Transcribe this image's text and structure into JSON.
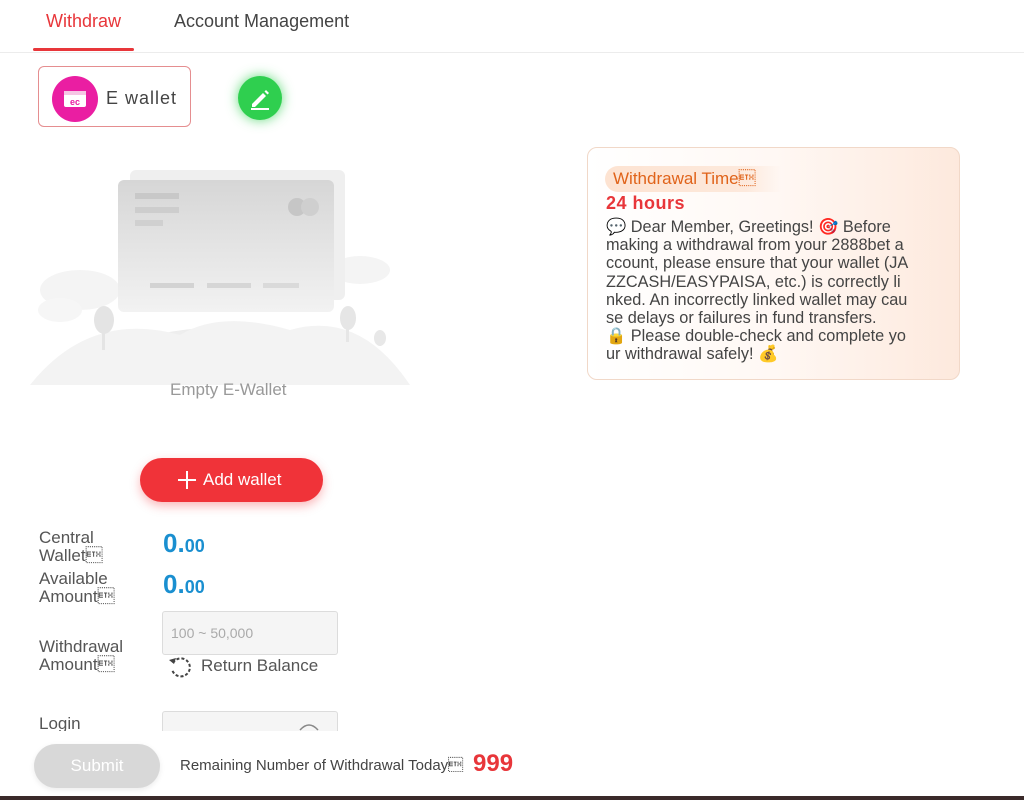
{
  "tabs": [
    {
      "label": "Withdraw",
      "active": true
    },
    {
      "label": "Account Management",
      "active": false
    }
  ],
  "wallet_type": {
    "label": "E wallet",
    "icon": "ewallet-icon",
    "color": "#ea1ea2"
  },
  "edit_icon": "pencil-icon",
  "empty_state": {
    "label": "Empty E-Wallet"
  },
  "add_wallet": {
    "label": "Add wallet",
    "icon": "plus-icon"
  },
  "form": {
    "central_wallet": {
      "label": "Central\nWallet\u0003",
      "value_int": "0.",
      "value_dec": "00"
    },
    "available_amount": {
      "label": "Available\nAmount\u0003",
      "value_int": "0.",
      "value_dec": "00"
    },
    "withdrawal_amount": {
      "label": "Withdrawal\nAmount\u0003",
      "placeholder": "100 ~ 50,000"
    },
    "return_balance": "Return Balance",
    "login_label": "Login"
  },
  "submit_label": "Submit",
  "remaining": {
    "label": "Remaining Number of Withdrawal Today\u0003",
    "count": "999"
  },
  "notice": {
    "time_title": "Withdrawal Time\u0003",
    "hours": "24 hours",
    "body": "💬 Dear Member, Greetings! 🎯 Before\nmaking a withdrawal from your 2888bet a\nccount, please ensure that your wallet (JA\nZZCASH/EASYPAISA, etc.) is correctly li\nnked. An incorrectly linked wallet may cau\nse delays or failures in fund transfers.\n🔒 Please double-check and complete yo\nur withdrawal safely! 💰"
  },
  "colors": {
    "accent": "#e8363a",
    "amount": "#1a8fd0",
    "edit": "#2fcf4f",
    "notice_title": "#e0631a"
  }
}
